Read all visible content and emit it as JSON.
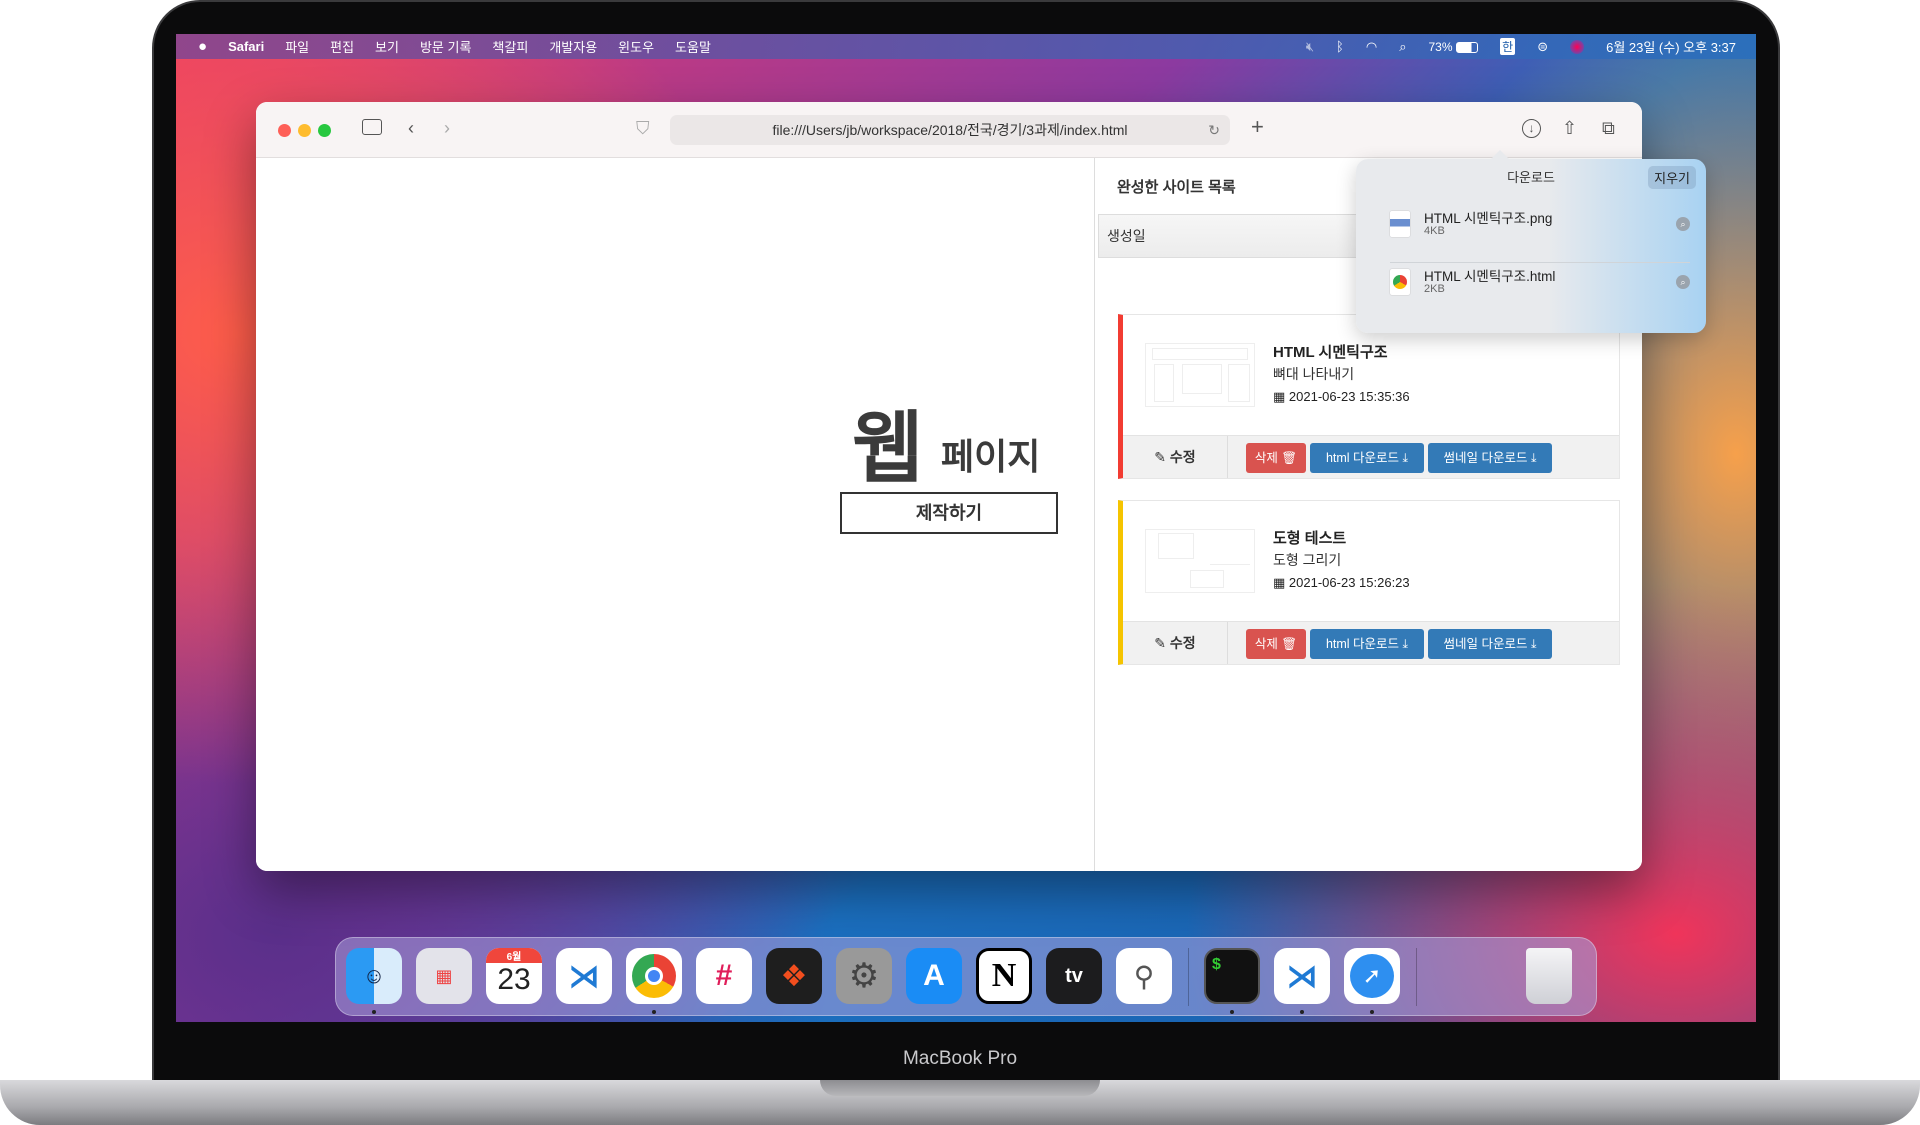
{
  "menubar": {
    "apple": "",
    "app": "Safari",
    "items": [
      "파일",
      "편집",
      "보기",
      "방문 기록",
      "책갈피",
      "개발자용",
      "윈도우",
      "도움말"
    ],
    "battery": "73%",
    "input_method": "한",
    "clock": "6월 23일 (수) 오후 3:37"
  },
  "safari": {
    "url": "file:///Users/jb/workspace/2018/전국/경기/3과제/index.html",
    "new_tab": "+"
  },
  "page": {
    "title_big": "웹",
    "title_small": "페이지",
    "make_button": "제작하기"
  },
  "list": {
    "title": "완성한 사이트 목록",
    "sort_label": "생성일",
    "cards": [
      {
        "title": "HTML 시멘틱구조",
        "desc": "뼈대 나타내기",
        "date": "2021-06-23 15:35:36",
        "accent": "#f23c32"
      },
      {
        "title": "도형 테스트",
        "desc": "도형 그리기",
        "date": "2021-06-23 15:26:23",
        "accent": "#f5c400"
      }
    ],
    "edit_label": "수정",
    "delete_label": "삭제",
    "html_download_label": "html 다운로드",
    "thumb_download_label": "썸네일 다운로드"
  },
  "downloads": {
    "title": "다운로드",
    "clear": "지우기",
    "items": [
      {
        "name": "HTML 시멘틱구조.png",
        "size": "4KB",
        "icon": "png-file-icon"
      },
      {
        "name": "HTML 시멘틱구조.html",
        "size": "2KB",
        "icon": "chrome-html-file-icon"
      }
    ]
  },
  "dock": {
    "calendar_month": "6월",
    "calendar_day": "23",
    "apps": [
      "Finder",
      "Launchpad",
      "Calendar",
      "Visual Studio Code",
      "Google Chrome",
      "Slack",
      "Figma",
      "System Preferences",
      "App Store",
      "Notion",
      "Apple TV",
      "System Information",
      "Terminal",
      "Visual Studio Code",
      "Safari",
      "Trash"
    ]
  },
  "device": "MacBook Pro"
}
